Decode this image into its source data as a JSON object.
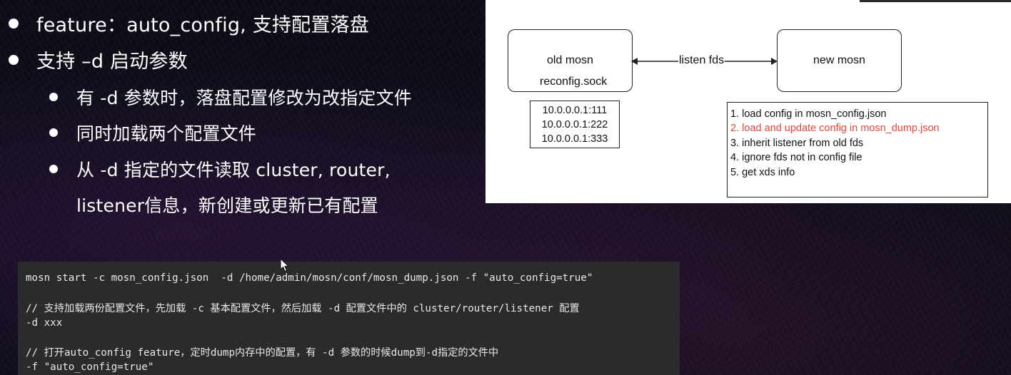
{
  "slide": {
    "bullets": [
      {
        "level": 1,
        "text": "feature：auto_config, 支持配置落盘"
      },
      {
        "level": 1,
        "text": "支持 –d 启动参数"
      },
      {
        "level": 2,
        "text": "有 -d 参数时，落盘配置修改为改指定文件"
      },
      {
        "level": 2,
        "text": "同时加载两个配置文件"
      },
      {
        "level": 2,
        "text": "从 -d 指定的文件读取 cluster, router,"
      },
      {
        "level": 2,
        "text": "listener信息，新创建或更新已有配置"
      }
    ]
  },
  "diagram": {
    "old_node": "old mosn",
    "old_sock": "reconfig.sock",
    "new_node": "new mosn",
    "arrow_label": "listen fds",
    "fds": [
      "10.0.0.0.1:111",
      "10.0.0.0.1:222",
      "10.0.0.0.1:333"
    ],
    "steps": [
      "1. load config in mosn_config.json",
      "2. load and update config in mosn_dump.json",
      "3. inherit listener from old fds",
      "4. ignore fds not in config file",
      "5. get xds info"
    ],
    "highlight_color": "#e0483e"
  },
  "code": {
    "lines": [
      "mosn start -c mosn_config.json  -d /home/admin/mosn/conf/mosn_dump.json -f \"auto_config=true\"",
      "",
      "// 支持加载两份配置文件，先加载 -c 基本配置文件，然后加载 -d 配置文件中的 cluster/router/listener 配置",
      "-d xxx",
      "",
      "// 打开auto_config feature，定时dump内存中的配置，有 -d 参数的时候dump到-d指定的文件中",
      "-f \"auto_config=true\""
    ]
  }
}
